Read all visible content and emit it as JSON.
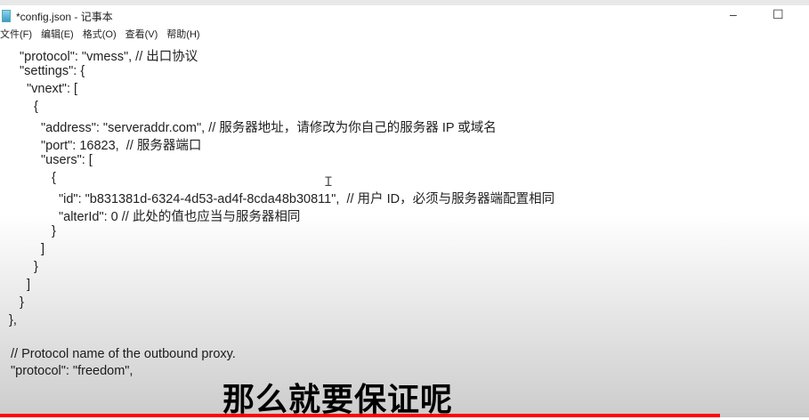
{
  "window": {
    "title": "*config.json - 记事本",
    "minimize": "–",
    "maximize": "☐"
  },
  "menu": [
    "文件(F)",
    "编辑(E)",
    "格式(O)",
    "查看(V)",
    "帮助(H)"
  ],
  "code_lines": [
    "\"protocol\": \"vmess\", // 出口协议",
    "\"settings\": {",
    "\"vnext\": [",
    "{",
    "\"address\": \"serveraddr.com\", // 服务器地址，请修改为你自己的服务器 IP 或域名",
    "\"port\": 16823,  // 服务器端口",
    "\"users\": [",
    "{",
    "\"id\": \"b831381d-6324-4d53-ad4f-8cda48b30811\",  // 用户 ID，必须与服务器端配置相同",
    "\"alterId\": 0 // 此处的值也应当与服务器相同",
    "}",
    "]",
    "}",
    "]",
    "}",
    "},",
    "",
    "// Protocol name of the outbound proxy.",
    "\"protocol\": \"freedom\","
  ],
  "subtitle": "那么就要保证呢",
  "video_progress": 0.89,
  "colors": {
    "progress": "#ff0000"
  }
}
